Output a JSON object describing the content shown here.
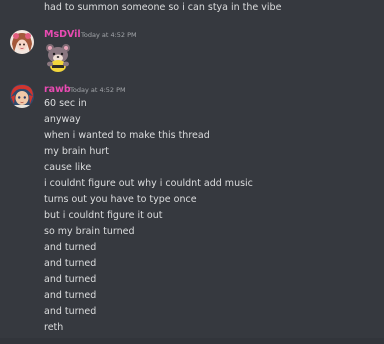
{
  "theme": {
    "background": "#36393f",
    "text": "#dcddde",
    "timestamp": "#a3a6aa",
    "author_msdvil": "#e94bb2",
    "author_rawb": "#e94bb2"
  },
  "messages": {
    "top": {
      "text": "had to summon someone so i can stya in the vibe"
    },
    "msdvil": {
      "author": "MsDVil",
      "timestamp": "Today at 4:52 PM",
      "avatar_icon": "anime-girl-avatar",
      "sticker_icon": "bear-sticker"
    },
    "rawb": {
      "author": "rawb",
      "timestamp": "Today at 4:52 PM",
      "avatar_icon": "anime-boy-avatar",
      "lines": [
        "60 sec in",
        "anyway",
        "when i wanted to make this thread",
        "my brain hurt",
        "cause like",
        "i couldnt figure out why i couldnt add music",
        "turns out you have to type once",
        "but i couldnt figure it out",
        "so my brain turned",
        "and turned",
        "and turned",
        "and turned",
        "and turned",
        "and turned",
        "reth"
      ]
    }
  }
}
